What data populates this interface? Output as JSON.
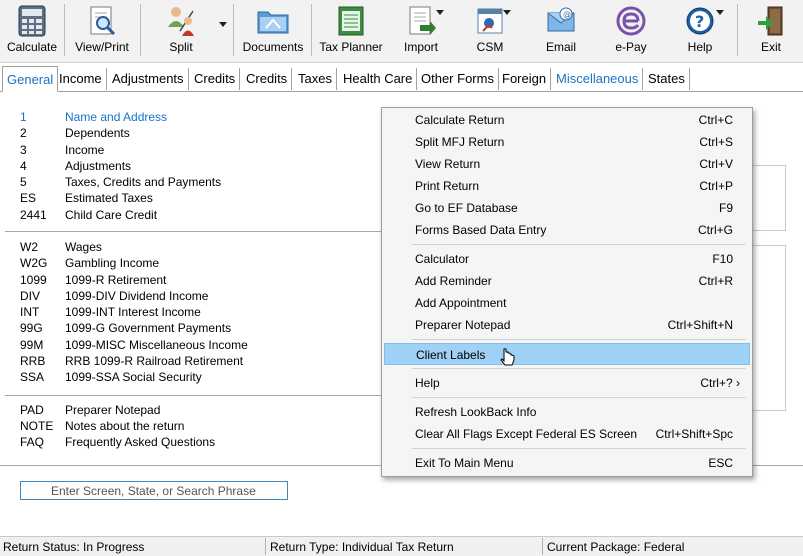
{
  "toolbar": {
    "buttons": [
      {
        "label": "Calculate",
        "icon": "calculator-icon"
      },
      {
        "label": "View/Print",
        "icon": "magnifier-page-icon"
      },
      {
        "label": "Split",
        "icon": "split-people-icon"
      },
      {
        "label": "Documents",
        "icon": "folder-icon"
      },
      {
        "label": "Tax Planner",
        "icon": "tax-planner-icon"
      },
      {
        "label": "Import",
        "icon": "import-icon"
      },
      {
        "label": "CSM",
        "icon": "csm-icon"
      },
      {
        "label": "Email",
        "icon": "email-icon"
      },
      {
        "label": "e-Pay",
        "icon": "epay-icon"
      },
      {
        "label": "Help",
        "icon": "help-icon"
      },
      {
        "label": "Exit",
        "icon": "exit-door-icon"
      }
    ]
  },
  "tabs": [
    "General",
    "Income",
    "Adjustments",
    "Credits",
    "Credits",
    "Taxes",
    "Health Care",
    "Other Forms",
    "Foreign",
    "Miscellaneous",
    "States"
  ],
  "screens": {
    "group1": [
      {
        "code": "1",
        "desc": "Name and Address"
      },
      {
        "code": "2",
        "desc": "Dependents"
      },
      {
        "code": "3",
        "desc": "Income"
      },
      {
        "code": "4",
        "desc": "Adjustments"
      },
      {
        "code": "5",
        "desc": "Taxes, Credits and Payments"
      },
      {
        "code": "ES",
        "desc": "Estimated Taxes"
      },
      {
        "code": "2441",
        "desc": "Child Care Credit"
      }
    ],
    "group2": [
      {
        "code": "W2",
        "desc": "Wages"
      },
      {
        "code": "W2G",
        "desc": "Gambling Income"
      },
      {
        "code": "1099",
        "desc": "1099-R  Retirement"
      },
      {
        "code": "DIV",
        "desc": "1099-DIV  Dividend Income"
      },
      {
        "code": "INT",
        "desc": "1099-INT  Interest Income"
      },
      {
        "code": "99G",
        "desc": "1099-G  Government Payments"
      },
      {
        "code": "99M",
        "desc": "1099-MISC  Miscellaneous Income"
      },
      {
        "code": "RRB",
        "desc": "RRB 1099-R  Railroad Retirement"
      },
      {
        "code": "SSA",
        "desc": "1099-SSA  Social Security"
      }
    ],
    "group3": [
      {
        "code": "PAD",
        "desc": "Preparer Notepad"
      },
      {
        "code": "NOTE",
        "desc": "Notes about the return"
      },
      {
        "code": "FAQ",
        "desc": "Frequently Asked Questions"
      }
    ]
  },
  "search": {
    "placeholder": "Enter Screen, State, or Search Phrase"
  },
  "context_menu": {
    "items": [
      {
        "label": "Calculate Return",
        "shortcut": "Ctrl+C"
      },
      {
        "label": "Split MFJ Return",
        "shortcut": "Ctrl+S"
      },
      {
        "label": "View Return",
        "shortcut": "Ctrl+V"
      },
      {
        "label": "Print Return",
        "shortcut": "Ctrl+P"
      },
      {
        "label": "Go to EF Database",
        "shortcut": "F9"
      },
      {
        "label": "Forms Based Data Entry",
        "shortcut": "Ctrl+G"
      },
      {
        "label": "Calculator",
        "shortcut": "F10"
      },
      {
        "label": "Add Reminder",
        "shortcut": "Ctrl+R"
      },
      {
        "label": "Add Appointment",
        "shortcut": ""
      },
      {
        "label": "Preparer Notepad",
        "shortcut": "Ctrl+Shift+N"
      },
      {
        "label": "Client Labels",
        "shortcut": ""
      },
      {
        "label": "Help",
        "shortcut": "Ctrl+? ›"
      },
      {
        "label": "Refresh LookBack Info",
        "shortcut": ""
      },
      {
        "label": "Clear All Flags Except Federal ES Screen",
        "shortcut": "Ctrl+Shift+Spc"
      },
      {
        "label": "Exit To Main Menu",
        "shortcut": "ESC"
      }
    ]
  },
  "status_bar": {
    "return_status": "Return Status: In Progress",
    "return_type": "Return Type: Individual Tax Return",
    "package": "Current Package: Federal"
  }
}
